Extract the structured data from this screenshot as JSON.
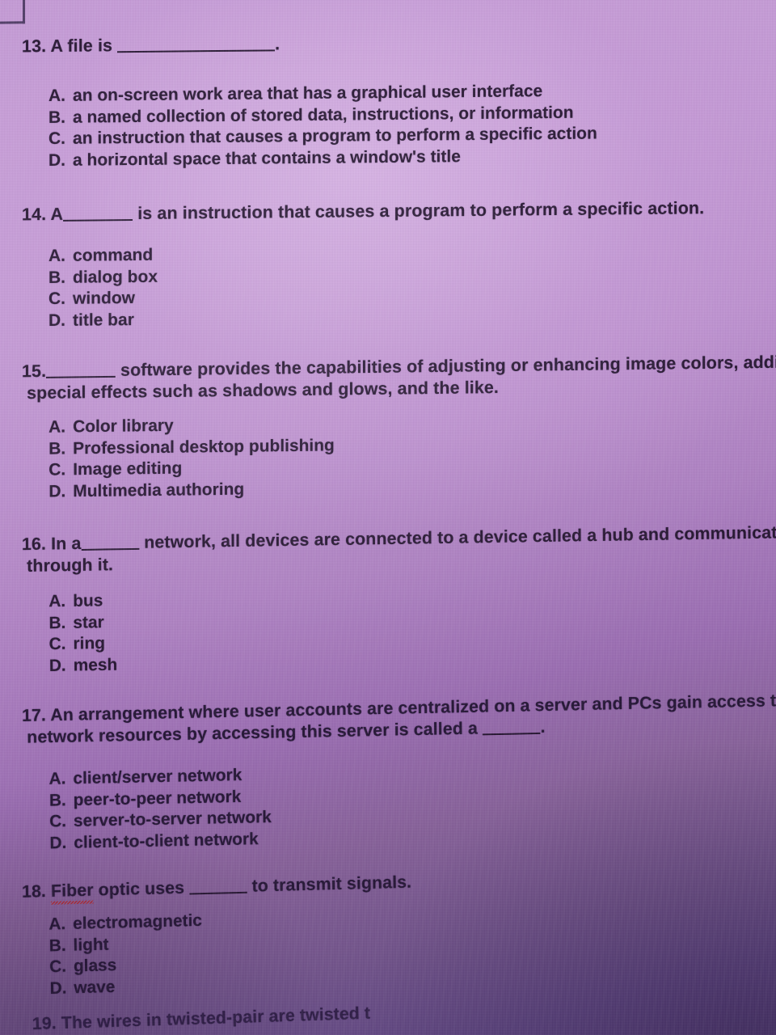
{
  "document": {
    "type": "multiple-choice quiz page",
    "visible_question_range": "13-19",
    "background_colors": {
      "top_light": "#c79ed8",
      "middle": "#b08ac4",
      "bottom_dark": "#533c76",
      "text": "#23132f",
      "spellcheck_underline": "#c02020"
    }
  },
  "questions": [
    {
      "number": "13.",
      "stem_before": "A file is",
      "blank": "long",
      "stem_after": ".",
      "options": [
        {
          "label": "A.",
          "text": "an on-screen work area that has a graphical user interface"
        },
        {
          "label": "B.",
          "text": "a named collection of stored data, instructions, or information"
        },
        {
          "label": "C.",
          "text": "an instruction that causes a program to perform a specific action"
        },
        {
          "label": "D.",
          "text": "a horizontal space that contains a window's title"
        }
      ]
    },
    {
      "number": "14.",
      "stem_before": "A",
      "blank": "medium",
      "stem_after": "is an instruction that causes a program to perform a specific action.",
      "options": [
        {
          "label": "A.",
          "text": "command"
        },
        {
          "label": "B.",
          "text": "dialog box"
        },
        {
          "label": "C.",
          "text": "window"
        },
        {
          "label": "D.",
          "text": "title bar"
        }
      ]
    },
    {
      "number": "15.",
      "stem_before": "",
      "blank": "medium",
      "stem_after": "software provides the capabilities of adjusting or enhancing image colors, addin",
      "stem_line2": "special effects such as shadows and glows, and the like.",
      "clipped_right": true,
      "options": [
        {
          "label": "A.",
          "text": "Color library"
        },
        {
          "label": "B.",
          "text": "Professional desktop publishing"
        },
        {
          "label": "C.",
          "text": "Image editing"
        },
        {
          "label": "D.",
          "text": "Multimedia authoring"
        }
      ]
    },
    {
      "number": "16.",
      "stem_before": "In a",
      "blank": "small",
      "stem_after": "network, all devices are connected to a device called a hub and communication",
      "stem_line2": "through it.",
      "clipped_right": true,
      "options": [
        {
          "label": "A.",
          "text": "bus"
        },
        {
          "label": "B.",
          "text": "star"
        },
        {
          "label": "C.",
          "text": "ring"
        },
        {
          "label": "D.",
          "text": "mesh"
        }
      ]
    },
    {
      "number": "17.",
      "stem_before": "An arrangement where user accounts are centralized on a server and PCs gain access to",
      "stem_line2_before": "network resources by accessing this server is called a",
      "blank": "small",
      "stem_line2_after": ".",
      "options": [
        {
          "label": "A.",
          "text": "client/server network"
        },
        {
          "label": "B.",
          "text": "peer-to-peer network"
        },
        {
          "label": "C.",
          "text": "server-to-server network"
        },
        {
          "label": "D.",
          "text": "client-to-client network"
        }
      ]
    },
    {
      "number": "18.",
      "stem_spellcheck_word": "Fiber",
      "stem_before": "optic uses",
      "blank": "small",
      "stem_after": "to transmit signals.",
      "options": [
        {
          "label": "A.",
          "text": "electromagnetic"
        },
        {
          "label": "B.",
          "text": "light"
        },
        {
          "label": "C.",
          "text": "glass"
        },
        {
          "label": "D.",
          "text": "wave"
        }
      ]
    },
    {
      "number": "19.",
      "stem_before": "The wires in twisted-pair are twisted t",
      "clipped_bottom": true,
      "options": []
    }
  ]
}
